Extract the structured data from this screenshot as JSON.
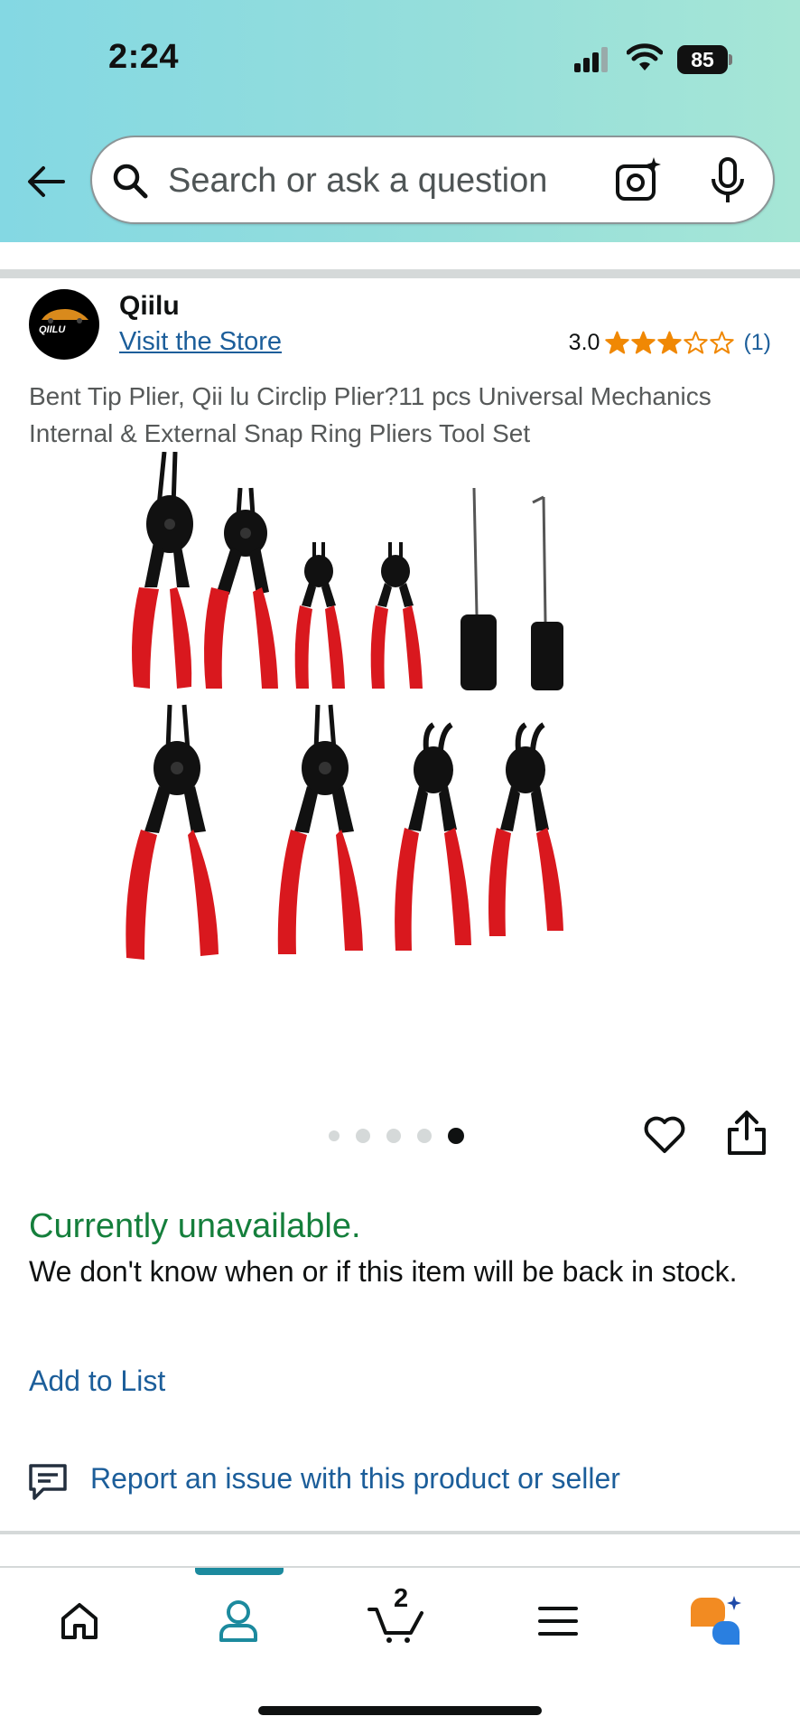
{
  "status_bar": {
    "time": "2:24",
    "battery": "85"
  },
  "search": {
    "placeholder": "Search or ask a question"
  },
  "seller": {
    "name": "Qiilu",
    "logo_text": "QIILU",
    "store_link": "Visit the Store"
  },
  "rating": {
    "value": "3.0",
    "stars": 3,
    "max_stars": 5,
    "count": "(1)",
    "star_color": "#f08804"
  },
  "product": {
    "title": "Bent Tip Plier, Qii lu Circlip Plier?11 pcs Universal Mechanics Internal & External Snap Ring Pliers Tool Set"
  },
  "carousel": {
    "total_images": 5,
    "active_index": 4
  },
  "availability": {
    "status": "Currently unavailable.",
    "message": "We don't know when or if this item will be back in stock.",
    "status_color": "#157f3c"
  },
  "actions": {
    "add_to_list": "Add to List",
    "report_issue": "Report an issue with this product or seller"
  },
  "bottom_nav": {
    "items": [
      {
        "icon": "home-icon"
      },
      {
        "icon": "account-icon",
        "active": true
      },
      {
        "icon": "cart-icon"
      },
      {
        "icon": "menu-icon"
      },
      {
        "icon": "rufus-assistant-icon"
      }
    ],
    "cart_count": "2",
    "active_color": "#1c8a9e"
  },
  "colors": {
    "link": "#1c5e9a",
    "header_gradient_start": "#84d8e3",
    "header_gradient_end": "#a6e6d6"
  }
}
